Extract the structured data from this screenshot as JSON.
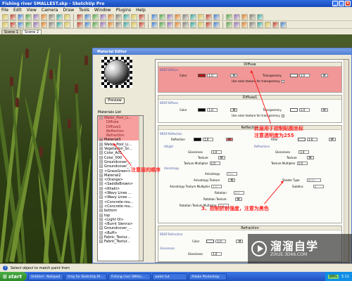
{
  "app": {
    "title": "Fishing river SMALLEST.skp - SketchUp Pro"
  },
  "menu": [
    "File",
    "Edit",
    "View",
    "Camera",
    "Draw",
    "Tools",
    "Window",
    "Plugins",
    "Help"
  ],
  "toolbar1_icons": [
    "select-icon",
    "eraser-icon",
    "paint-icon",
    "line-icon",
    "arc-icon",
    "rectangle-icon",
    "circle-icon",
    "polygon-icon",
    "freehand-icon",
    "move-icon",
    "pushpull-icon",
    "rotate-icon",
    "followme-icon",
    "scale-icon",
    "offset-icon",
    "tape-icon",
    "dimension-icon",
    "protractor-icon",
    "text-icon",
    "axes-icon",
    "3dtext-icon",
    "orbit-icon",
    "pan-icon",
    "zoom-icon",
    "zoomwindow-icon",
    "zoomextents-icon",
    "previous-icon",
    "next-icon",
    "position-camera-icon",
    "walk-icon",
    "lookaround-icon",
    "section-icon"
  ],
  "toolbar2_icons": [
    "new-icon",
    "open-icon",
    "save-icon",
    "cut-icon",
    "copy-icon",
    "paste-icon",
    "erase-icon",
    "undo-icon",
    "redo-icon",
    "print-icon",
    "user-icon",
    "iso-icon",
    "top-icon",
    "front-icon",
    "right-icon",
    "back-icon",
    "left-icon",
    "xray-icon",
    "wireframe-icon",
    "hiddenline-icon",
    "shaded-icon",
    "textured-icon",
    "monochrome-icon",
    "shadows-icon",
    "fog-icon",
    "components-icon",
    "materials-icon",
    "styles-icon",
    "layers-icon",
    "outliner-icon",
    "scenes-icon",
    "softening-icon",
    "render-icon",
    "settings-icon",
    "help-icon"
  ],
  "scenes": [
    "Scene 1",
    "Scene 2"
  ],
  "dialog": {
    "title": "Material Editor",
    "preview_label": "Preview",
    "materials_list_label": "Materials List",
    "materials": [
      {
        "label": "Water_Pool_Li...",
        "kind": "parent",
        "expanded": true
      },
      {
        "label": "Diffuse",
        "kind": "sub"
      },
      {
        "label": "Diffuse1",
        "kind": "sub"
      },
      {
        "label": "Reflection",
        "kind": "sub"
      },
      {
        "label": "Refraction",
        "kind": "sub"
      },
      {
        "label": "Material3",
        "kind": "item"
      },
      {
        "label": "Water_Pool_Li...",
        "kind": "item"
      },
      {
        "label": "Vegetation_Gr...",
        "kind": "item"
      },
      {
        "label": "Color_A01",
        "kind": "item"
      },
      {
        "label": "Color_000",
        "kind": "item"
      },
      {
        "label": "Groundcover_...",
        "kind": "item"
      },
      {
        "label": "Groundcover_...",
        "kind": "item"
      },
      {
        "label": "<GrassGreen>",
        "kind": "item"
      },
      {
        "label": "Material2",
        "kind": "item"
      },
      {
        "label": "<Orange>",
        "kind": "item"
      },
      {
        "label": "<SaddleBrown>",
        "kind": "item"
      },
      {
        "label": "<Khaki>",
        "kind": "item"
      },
      {
        "label": "<Wavy Lines ...",
        "kind": "item"
      },
      {
        "label": "<Wavy Lines ...",
        "kind": "item"
      },
      {
        "label": "<Concrete-rou...",
        "kind": "item"
      },
      {
        "label": "<Concrete-rou...",
        "kind": "item"
      },
      {
        "label": "bottom",
        "kind": "item"
      },
      {
        "label": "top",
        "kind": "item"
      },
      {
        "label": "<Light Ol>",
        "kind": "item"
      },
      {
        "label": "<Burnt Sienna>",
        "kind": "item"
      },
      {
        "label": "Groundcover_...",
        "kind": "item"
      },
      {
        "label": "<Buff>",
        "kind": "item"
      },
      {
        "label": "Fabric_Textur...",
        "kind": "item"
      },
      {
        "label": "Fabric_Textur...",
        "kind": "item"
      }
    ],
    "diffuse": {
      "header": "Diffuse",
      "sub": "BRDF:Diffuse",
      "color_label": "Color",
      "value1": "1.0",
      "m": "M",
      "transparency_label": "Transparency",
      "value2": "1.0",
      "use_texture_label": "Use color texture for transparency"
    },
    "diffuse1": {
      "header": "Diffuse1",
      "sub": "BRDF:Diffuse",
      "color_label": "Color",
      "value1": "1.0",
      "m": "M",
      "transparency_label": "Transparency",
      "value2": "1.0",
      "use_texture_label": "Use color texture for transparency"
    },
    "reflection": {
      "header": "Reflection",
      "sub": "BRDF:Reflection",
      "reflection_label": "Reflection",
      "filter_label": "Filter",
      "value1": "1.0",
      "value2": "1.0",
      "m": "M",
      "highlight_label": "Hilight",
      "reflections_label": "Reflections",
      "glossiness_label": "Glossiness",
      "glossiness_value": "1.0",
      "glossiness2_value": "1.0",
      "texture_label": "Texture",
      "texture_multiplier_label": "Texture Multiplier",
      "texture_multiplier_value": "1.0",
      "texture_multiplier2_value": "1.0",
      "anisotropy_label": "Anisotropy",
      "anisotropy_value": "0.0",
      "aniso_texture_label": "Anisotropy Texture",
      "aniso_texmult_label": "Anisotropy Texture Multiplier",
      "aniso_texmult_value": "1.0",
      "rotation_label": "Rotation",
      "rotation_value": "0.0",
      "rotation_texture_label": "Rotation Texture",
      "rotation_texmult_label": "Rotation Texture Multiplier",
      "rotation_texmult_value": "1.0",
      "shader_type_label": "Shader Type",
      "shader_type_value": "Blinn",
      "subdivs_label": "Subdivs",
      "subdivs_value": "8"
    },
    "refraction": {
      "header": "Refraction",
      "sub": "BRDF:Refraction",
      "color_label": "Color",
      "value1": "1.0",
      "m": "M",
      "glossiness_section_label": "Glossiness",
      "glossiness_label": "Glossiness",
      "glossiness_value": "1.0"
    }
  },
  "annotations": {
    "a1_line1": "此层用于控制贴图坐标",
    "a1_line2": "注意透明度为255",
    "a2": "注意层的顺序",
    "a3": "3、控制折射强度，注意为黑色"
  },
  "watermark": {
    "title": "溜溜自学",
    "subtitle": "ZIXUE.3D66.COM"
  },
  "status": {
    "text": "Select object to match paint from"
  },
  "taskbar": {
    "start": "start",
    "tasks": [
      "Untitled - Notepad",
      "Vray for SketchUp M...",
      "Fishing river SMALL...",
      "water tut",
      "Adobe Photoshop"
    ],
    "battery": "99%",
    "time": "3:11"
  },
  "colors": {
    "titlebar": "#1f55c8",
    "highlight_red": "#e96060",
    "annotation_red": "#ff2020"
  }
}
